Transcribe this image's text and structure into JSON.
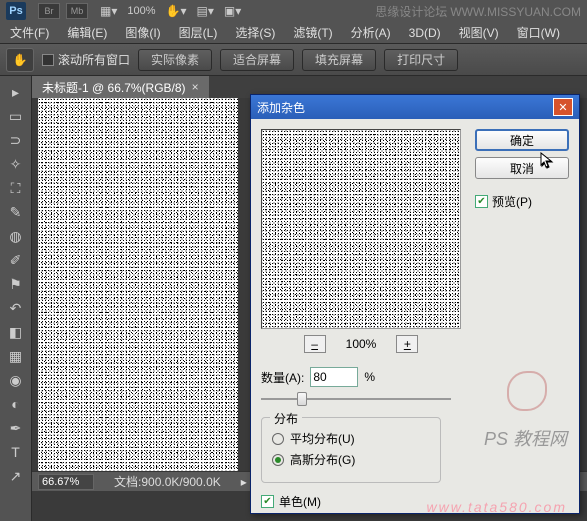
{
  "topbar": {
    "logo": "Ps",
    "br": "Br",
    "mb": "Mb",
    "zoom": "100%",
    "site_label": "思缘设计论坛",
    "site_url": "WWW.MISSYUAN.COM"
  },
  "menu": {
    "file": "文件(F)",
    "edit": "编辑(E)",
    "image": "图像(I)",
    "layer": "图层(L)",
    "select": "选择(S)",
    "filter": "滤镜(T)",
    "analysis": "分析(A)",
    "three_d": "3D(D)",
    "view": "视图(V)",
    "window": "窗口(W)"
  },
  "options": {
    "scroll_all": "滚动所有窗口",
    "actual_pixels": "实际像素",
    "fit_screen": "适合屏幕",
    "fill_screen": "填充屏幕",
    "print_size": "打印尺寸"
  },
  "document": {
    "tab_title": "未标题-1 @ 66.7%(RGB/8)",
    "zoom_value": "66.67%",
    "doc_info_label": "文档:",
    "doc_info": "900.0K/900.0K"
  },
  "dialog": {
    "title": "添加杂色",
    "ok": "确定",
    "cancel": "取消",
    "preview": "预览(P)",
    "zoom_percent": "100%",
    "amount_label": "数量(A):",
    "amount_value": "80",
    "amount_unit": "%",
    "distribution_legend": "分布",
    "uniform": "平均分布(U)",
    "gaussian": "高斯分布(G)",
    "monochrome": "单色(M)",
    "slider_percent": 20
  },
  "watermark": {
    "line1": "PS 教程网",
    "line2": "www.tata580.com"
  }
}
